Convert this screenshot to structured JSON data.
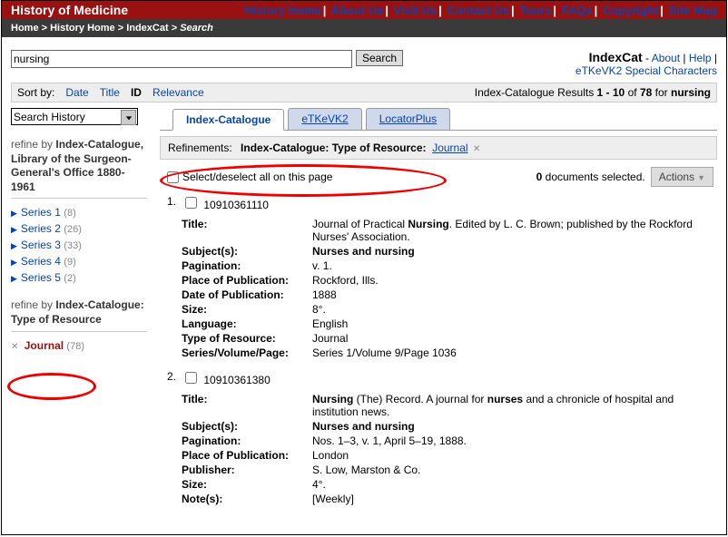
{
  "header": {
    "title": "History of Medicine",
    "nav": [
      "History Home",
      "About Us",
      "Visit Us",
      "Contact Us",
      "Tours",
      "FAQs",
      "Copyright",
      "Site Map"
    ]
  },
  "breadcrumb": {
    "home": "Home",
    "hist": "History Home",
    "ic": "IndexCat",
    "search": "Search"
  },
  "search": {
    "value": "nursing",
    "button": "Search",
    "ic_label": "IndexCat",
    "about": "About",
    "help": "Help",
    "special": "eTKeVK2 Special Characters"
  },
  "sortbar": {
    "label": "Sort by:",
    "date": "Date",
    "title": "Title",
    "id": "ID",
    "rel": "Relevance",
    "results_prefix": "Index-Catalogue Results",
    "range": "1 - 10",
    "of": "of",
    "total": "78",
    "for": "for",
    "term": "nursing"
  },
  "sidebar": {
    "history_label": "Search History",
    "refine1_prefix": "refine by",
    "refine1_bold": "Index-Catalogue, Library of the Surgeon-General's Office 1880-1961",
    "series": [
      {
        "label": "Series 1",
        "count": "(8)"
      },
      {
        "label": "Series 2",
        "count": "(26)"
      },
      {
        "label": "Series 3",
        "count": "(33)"
      },
      {
        "label": "Series 4",
        "count": "(9)"
      },
      {
        "label": "Series 5",
        "count": "(2)"
      }
    ],
    "refine2_prefix": "refine by",
    "refine2_bold": "Index-Catalogue: Type of Resource",
    "journal_label": "Journal",
    "journal_count": "(78)"
  },
  "tabs": {
    "ic": "Index-Catalogue",
    "etk": "eTKeVK2",
    "lp": "LocatorPlus"
  },
  "refinements": {
    "label": "Refinements:",
    "text": "Index-Catalogue: Type of Resource:",
    "value": "Journal"
  },
  "selectrow": {
    "label": "Select/deselect all on this page",
    "docsel_count": "0",
    "docsel_label": "documents selected.",
    "actions": "Actions"
  },
  "results": [
    {
      "num": "1.",
      "id": "10910361110",
      "fields": {
        "Title": "Journal of Practical <b>Nursing</b>. Edited by L. C. Brown; published by the Rockford Nurses' Association.",
        "Subject(s)": "<b>Nurses and nursing</b>",
        "Pagination": "v. 1.",
        "Place of Publication": "Rockford, Ills.",
        "Date of Publication": "1888",
        "Size": "8°.",
        "Language": "English",
        "Type of Resource": "Journal",
        "Series/Volume/Page": "Series 1/Volume 9/Page 1036"
      }
    },
    {
      "num": "2.",
      "id": "10910361380",
      "fields": {
        "Title": "<b>Nursing</b> (The) Record. A journal for <b>nurses</b> and a chronicle of hospital and institution news.",
        "Subject(s)": "<b>Nurses and nursing</b>",
        "Pagination": "Nos. 1–3, v. 1, April 5–19, 1888.",
        "Place of Publication": "London",
        "Publisher": "S. Low, Marston & Co.",
        "Size": "4°.",
        "Note(s)": "[Weekly]"
      }
    }
  ]
}
